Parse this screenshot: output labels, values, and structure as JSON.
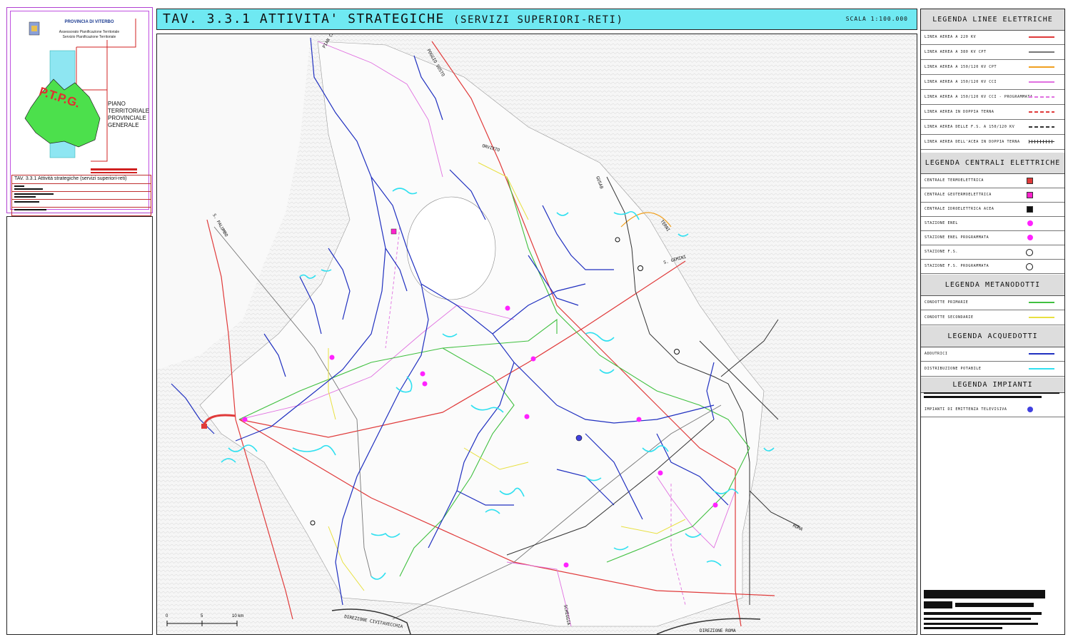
{
  "title": {
    "main": "TAV. 3.3.1 ATTIVITA' STRATEGICHE",
    "sub": "(SERVIZI SUPERIORI-RETI)",
    "scale": "SCALA 1:100.000"
  },
  "cartouche": {
    "province": "PROVINCIA DI VITERBO",
    "office_1": "Assessorato Pianificazione Territoriale",
    "office_2": "Servizio Pianificazione Territoriale",
    "plan_line1": "PIANO",
    "plan_line2": "TERRITORIALE",
    "plan_line3": "PROVINCIALE",
    "plan_line4": "GENERALE",
    "acronym": "P.T.P.G.",
    "tav_label": "TAV. 3.3.1 Attività strategiche (servizi superiori-reti)"
  },
  "legend": {
    "electric_lines_title": "LEGENDA LINEE ELETTRICHE",
    "electric_lines": [
      {
        "label": "LINEA AEREA A 220 KV",
        "color": "#e03a3a",
        "style": "solid"
      },
      {
        "label": "LINEA AEREA A 380 KV CPT",
        "color": "#777777",
        "style": "solid"
      },
      {
        "label": "LINEA AEREA A 150/120 KV CPT",
        "color": "#f0a020",
        "style": "solid"
      },
      {
        "label": "LINEA AEREA A 150/120 KV CCI",
        "color": "#e070e0",
        "style": "solid"
      },
      {
        "label": "LINEA AEREA A 150/120 KV CCI - PROGRAMMATA",
        "color": "#e070e0",
        "style": "dashed"
      },
      {
        "label": "LINEA AEREA IN DOPPIA TERNA",
        "color": "#e03a3a",
        "style": "dashed"
      },
      {
        "label": "LINEA AEREA DELLE F.S. A 150/120 KV",
        "color": "#333333",
        "style": "dashed"
      },
      {
        "label": "LINEA AEREA DELL'ACEA IN DOPPIA TERNA",
        "color": "#333333",
        "style": "hatched"
      }
    ],
    "power_plants_title": "LEGENDA CENTRALI ELETTRICHE",
    "power_plants": [
      {
        "label": "CENTRALE TERMOELETTRICA",
        "color": "#e03a3a",
        "shape": "square"
      },
      {
        "label": "CENTRALE GEOTERMOELETTRICA",
        "color": "#ff22cc",
        "shape": "square"
      },
      {
        "label": "CENTRALE IDROELETTRICA ACEA",
        "color": "#111111",
        "shape": "square"
      },
      {
        "label": "STAZIONE ENEL",
        "color": "#ff22ff",
        "shape": "dot"
      },
      {
        "label": "STAZIONE ENEL PROGRAMMATA",
        "color": "#ff22ff",
        "shape": "dot"
      },
      {
        "label": "STAZIONE F.S.",
        "color": "#ffffff",
        "shape": "ring"
      },
      {
        "label": "STAZIONE F.S. PROGRAMMATA",
        "color": "#111111",
        "shape": "ring"
      }
    ],
    "gas_title": "LEGENDA METANODOTTI",
    "gas": [
      {
        "label": "CONDOTTE PRIMARIE",
        "color": "#40c040"
      },
      {
        "label": "CONDOTTE SECONDARIE",
        "color": "#e8e040"
      }
    ],
    "water_title": "LEGENDA ACQUEDOTTI",
    "water": [
      {
        "label": "ADDUTRICI",
        "color": "#2030c0"
      },
      {
        "label": "DISTRIBUZIONE POTABILE",
        "color": "#30e0f0"
      }
    ],
    "plants_title": "LEGENDA IMPIANTI",
    "plants": [
      {
        "label": "IMPIANTI DI EMITTENZA TELEVISIVA",
        "color": "#4040e0"
      }
    ]
  },
  "map_labels": [
    {
      "text": "PIAN CASTAGNAIO"
    },
    {
      "text": "POGGIO SUSTO"
    },
    {
      "text": "ORVIETO"
    },
    {
      "text": "GUSAB"
    },
    {
      "text": "TERNI"
    },
    {
      "text": "S. GEMINI"
    },
    {
      "text": "S. PALUMBO"
    },
    {
      "text": "ROMA"
    },
    {
      "text": "DIREZIONE CIVITAVECCHIA"
    },
    {
      "text": "DIREZIONE ROMA"
    },
    {
      "text": "SCHEGGIA"
    }
  ],
  "scalebar": {
    "t0": "0",
    "t1": "5",
    "t2": "10 km"
  }
}
